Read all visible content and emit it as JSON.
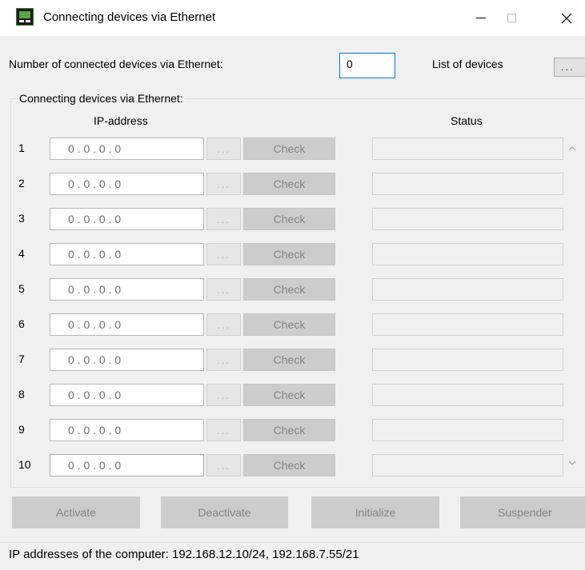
{
  "window": {
    "title": "Connecting devices via Ethernet",
    "icon": "app-monitor-icon"
  },
  "header": {
    "count_label": "Number of connected devices via Ethernet:",
    "count_value": "0",
    "list_label": "List of devices",
    "list_button": "..."
  },
  "group": {
    "label": "Connecting devices via Ethernet:",
    "col_ip": "IP-address",
    "col_status": "Status"
  },
  "rows": [
    {
      "num": "1",
      "ip": "0 . 0 . 0 . 0",
      "dots": "...",
      "check": "Check",
      "status": ""
    },
    {
      "num": "2",
      "ip": "0 . 0 . 0 . 0",
      "dots": "...",
      "check": "Check",
      "status": ""
    },
    {
      "num": "3",
      "ip": "0 . 0 . 0 . 0",
      "dots": "...",
      "check": "Check",
      "status": ""
    },
    {
      "num": "4",
      "ip": "0 . 0 . 0 . 0",
      "dots": "...",
      "check": "Check",
      "status": ""
    },
    {
      "num": "5",
      "ip": "0 . 0 . 0 . 0",
      "dots": "...",
      "check": "Check",
      "status": ""
    },
    {
      "num": "6",
      "ip": "0 . 0 . 0 . 0",
      "dots": "...",
      "check": "Check",
      "status": ""
    },
    {
      "num": "7",
      "ip": "0 . 0 . 0 . 0",
      "dots": "...",
      "check": "Check",
      "status": ""
    },
    {
      "num": "8",
      "ip": "0 . 0 . 0 . 0",
      "dots": "...",
      "check": "Check",
      "status": ""
    },
    {
      "num": "9",
      "ip": "0 . 0 . 0 . 0",
      "dots": "...",
      "check": "Check",
      "status": ""
    },
    {
      "num": "10",
      "ip": "0 . 0 . 0 . 0",
      "dots": "...",
      "check": "Check",
      "status": ""
    }
  ],
  "actions": {
    "activate": "Activate",
    "deactivate": "Deactivate",
    "initialize": "Initialize",
    "suspender": "Suspender"
  },
  "footer": {
    "text": "IP addresses of the computer: 192.168.12.10/24, 192.168.7.55/21"
  },
  "colors": {
    "accent": "#0078d7",
    "disabled_bg": "#cccccc",
    "disabled_text": "#838383"
  }
}
